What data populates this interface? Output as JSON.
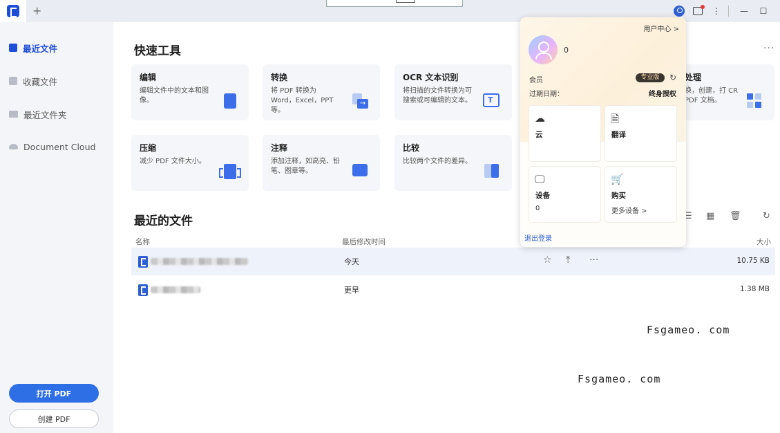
{
  "titlebar": {
    "new_tab": "+",
    "minimize": "—",
    "maximize": "☐",
    "more": "⋮"
  },
  "sidebar": {
    "items": [
      {
        "label": "最近文件"
      },
      {
        "label": "收藏文件"
      },
      {
        "label": "最近文件夹"
      },
      {
        "label": "Document Cloud"
      }
    ],
    "open_button": "打开 PDF",
    "create_button": "创建 PDF"
  },
  "quick_tools": {
    "title": "快速工具",
    "more": "···",
    "cards": [
      {
        "title": "编辑",
        "desc": "编辑文件中的文本和图像。"
      },
      {
        "title": "转换",
        "desc": "将 PDF 转换为 Word，Excel，PPT等。"
      },
      {
        "title": "OCR 文本识别",
        "desc": "将扫描的文件转换为可搜索或可编辑的文本。"
      },
      {
        "title": "处理",
        "desc": "换，创建，打 CR PDF 文档。"
      },
      {
        "title": "压缩",
        "desc": "减少 PDF 文件大小。"
      },
      {
        "title": "注释",
        "desc": "添加注释，如高亮、铅笔、图章等。"
      },
      {
        "title": "比较",
        "desc": "比较两个文件的差异。"
      }
    ]
  },
  "recent_files": {
    "title": "最近的文件",
    "columns": {
      "name": "名称",
      "modified": "最后修改时间",
      "size": "大小"
    },
    "rows": [
      {
        "modified": "今天",
        "size": "10.75 KB"
      },
      {
        "modified": "更早",
        "size": "1.38 MB"
      }
    ]
  },
  "account_popup": {
    "user_center": "用户中心 >",
    "user_count": "0",
    "member_label": "会员",
    "pro_badge": "专业版",
    "expiry_label": "过期日期：",
    "expiry_value": "终身授权",
    "cards": [
      {
        "title": "云",
        "sub": ""
      },
      {
        "title": "翻译",
        "sub": ""
      },
      {
        "title": "设备",
        "sub": "0"
      },
      {
        "title": "购买",
        "sub": "更多设备 >"
      }
    ],
    "logout": "退出登录"
  },
  "watermarks": [
    "Fsgameo. com",
    "Fsgameo. com"
  ],
  "colors": {
    "accent": "#2f6fe6",
    "brand": "#1e4ed8",
    "sidebar_bg": "#f4f5f9"
  }
}
